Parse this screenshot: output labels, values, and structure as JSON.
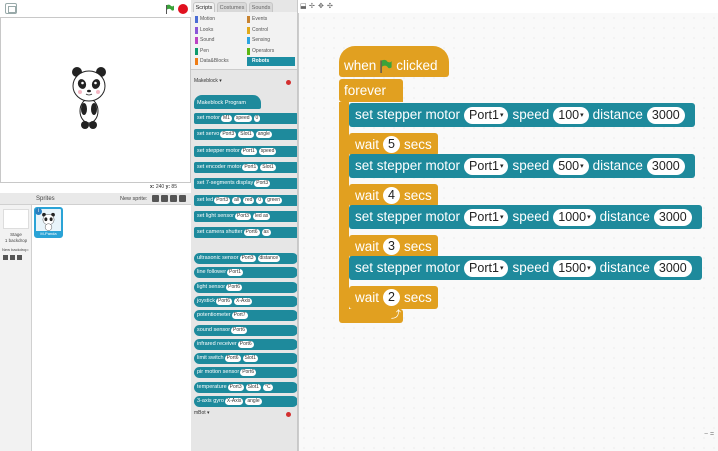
{
  "stage": {
    "x_label": "x:",
    "x_value": "240",
    "y_label": "y:",
    "y_value": "85"
  },
  "sprites": {
    "header": "Sprites",
    "new_sprite_label": "New sprite:",
    "stage_label": "Stage",
    "backdrop_count": "1 backdrop",
    "new_backdrop_label": "New backdrop:",
    "sprite_name": "M-Panda"
  },
  "tabs": [
    "Scripts",
    "Costumes",
    "Sounds"
  ],
  "categories": [
    {
      "label": "Motion",
      "color": "#4a6cd4"
    },
    {
      "label": "Events",
      "color": "#c88330"
    },
    {
      "label": "Looks",
      "color": "#8a55d7"
    },
    {
      "label": "Control",
      "color": "#e1a91a"
    },
    {
      "label": "Sound",
      "color": "#bb42c3"
    },
    {
      "label": "Sensing",
      "color": "#2ca5e2"
    },
    {
      "label": "Pen",
      "color": "#0e9a6c"
    },
    {
      "label": "Operators",
      "color": "#5cb712"
    },
    {
      "label": "Data&Blocks",
      "color": "#ee7d16"
    },
    {
      "label": "Robots",
      "color": "#1d8ea3"
    }
  ],
  "palette": {
    "ext_header": "Makeblock",
    "ext_footer": "mBot",
    "program_block": "Makeblock Program",
    "command_blocks": [
      {
        "text": "set motor",
        "args": [
          "M1",
          "speed",
          "0"
        ]
      },
      {
        "text": "set servo",
        "args": [
          "Port3",
          "Slot1",
          "angle"
        ]
      },
      {
        "text": "set stepper motor",
        "args": [
          "Port1",
          "speed"
        ]
      },
      {
        "text": "set encoder motor",
        "args": [
          "Port1",
          "Slot1"
        ]
      },
      {
        "text": "set 7-segments display",
        "args": [
          "Port3"
        ]
      },
      {
        "text": "set led",
        "args": [
          "Port3",
          "all",
          "red",
          "0",
          "green"
        ]
      },
      {
        "text": "set light sensor",
        "args": [
          "Port3",
          "led as"
        ]
      },
      {
        "text": "set camera shutter",
        "args": [
          "Port6",
          "as"
        ]
      }
    ],
    "reporter_blocks": [
      {
        "text": "ultrasonic sensor",
        "args": [
          "Port3",
          "distance"
        ]
      },
      {
        "text": "line follower",
        "args": [
          "Port1"
        ]
      },
      {
        "text": "light sensor",
        "args": [
          "Port6"
        ]
      },
      {
        "text": "joystick",
        "args": [
          "Port6",
          "X-Axis"
        ]
      },
      {
        "text": "potentiometer",
        "args": [
          "Port7"
        ]
      },
      {
        "text": "sound sensor",
        "args": [
          "Port6"
        ]
      },
      {
        "text": "infrared receiver",
        "args": [
          "Port6"
        ]
      },
      {
        "text": "limit switch",
        "args": [
          "Port6",
          "Slot1"
        ]
      },
      {
        "text": "pir motion sensor",
        "args": [
          "Port6"
        ]
      },
      {
        "text": "temperature",
        "args": [
          "Port3",
          "Slot1",
          "°C"
        ]
      },
      {
        "text": "3-axis gyro",
        "args": [
          "X-Axis",
          "angle"
        ]
      }
    ]
  },
  "script": {
    "hat_when": "when",
    "hat_clicked": "clicked",
    "forever": "forever",
    "steps": [
      {
        "type": "stepper",
        "text1": "set stepper motor",
        "port": "Port1",
        "text2": "speed",
        "speed": "100",
        "text3": "distance",
        "distance": "3000"
      },
      {
        "type": "wait",
        "text1": "wait",
        "value": "5",
        "text2": "secs"
      },
      {
        "type": "stepper",
        "text1": "set stepper motor",
        "port": "Port1",
        "text2": "speed",
        "speed": "500",
        "text3": "distance",
        "distance": "3000"
      },
      {
        "type": "wait",
        "text1": "wait",
        "value": "4",
        "text2": "secs"
      },
      {
        "type": "stepper",
        "text1": "set stepper motor",
        "port": "Port1",
        "text2": "speed",
        "speed": "1000",
        "text3": "distance",
        "distance": "3000"
      },
      {
        "type": "wait",
        "text1": "wait",
        "value": "3",
        "text2": "secs"
      },
      {
        "type": "stepper",
        "text1": "set stepper motor",
        "port": "Port1",
        "text2": "speed",
        "speed": "1500",
        "text3": "distance",
        "distance": "3000"
      },
      {
        "type": "wait",
        "text1": "wait",
        "value": "2",
        "text2": "secs"
      }
    ]
  },
  "colors": {
    "control": "#e1a020",
    "robots": "#1e8a9c",
    "selection": "#2aa3d6",
    "stop": "#e0101e",
    "flag": "#3aa33a"
  },
  "icons": [
    "green-flag-icon",
    "stop-icon",
    "paintbrush-icon",
    "folder-icon",
    "camera-icon",
    "stamp-icon",
    "scissors-icon",
    "grow-icon",
    "shrink-icon",
    "undo-arrow-icon"
  ]
}
